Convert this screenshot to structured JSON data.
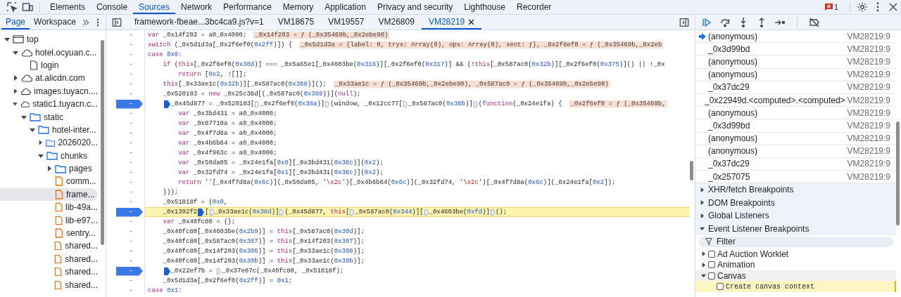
{
  "devtools_tabs": [
    {
      "label": "Elements",
      "selected": false
    },
    {
      "label": "Console",
      "selected": false
    },
    {
      "label": "Sources",
      "selected": true
    },
    {
      "label": "Network",
      "selected": false
    },
    {
      "label": "Performance",
      "selected": false
    },
    {
      "label": "Memory",
      "selected": false
    },
    {
      "label": "Application",
      "selected": false
    },
    {
      "label": "Privacy and security",
      "selected": false
    },
    {
      "label": "Lighthouse",
      "selected": false
    },
    {
      "label": "Recorder",
      "selected": false
    }
  ],
  "issues_count": "1",
  "navigator_tabs": [
    {
      "label": "Page",
      "selected": true
    },
    {
      "label": "Workspace",
      "selected": false
    }
  ],
  "file_tree": [
    {
      "label": "top",
      "kind": "frame",
      "expanded": true,
      "selected": false,
      "children": [
        {
          "label": "hotel.ocyuan.c...",
          "kind": "domain",
          "expanded": true,
          "selected": false,
          "children": [
            {
              "label": "login",
              "kind": "document",
              "selected": false
            }
          ]
        },
        {
          "label": "at.alicdn.com",
          "kind": "domain",
          "expanded": false,
          "selected": false
        },
        {
          "label": "images.tuyacn....",
          "kind": "domain",
          "expanded": false,
          "selected": false
        },
        {
          "label": "static1.tuyacn.c...",
          "kind": "domain",
          "expanded": true,
          "selected": false,
          "children": [
            {
              "label": "static",
              "kind": "folder",
              "expanded": true,
              "selected": false,
              "children": [
                {
                  "label": "hotel-inter...",
                  "kind": "folder",
                  "expanded": true,
                  "selected": false,
                  "children": [
                    {
                      "label": "2026020...",
                      "kind": "folder",
                      "expanded": false,
                      "selected": false
                    },
                    {
                      "label": "chunks",
                      "kind": "folder",
                      "expanded": true,
                      "selected": false,
                      "children": [
                        {
                          "label": "pages",
                          "kind": "folder",
                          "expanded": false,
                          "selected": false
                        },
                        {
                          "label": "comm...",
                          "kind": "script",
                          "selected": false
                        },
                        {
                          "label": "frame...",
                          "kind": "script",
                          "selected": true
                        },
                        {
                          "label": "lib-49a...",
                          "kind": "script",
                          "selected": false
                        },
                        {
                          "label": "lib-e97...",
                          "kind": "script",
                          "selected": false
                        },
                        {
                          "label": "sentry...",
                          "kind": "script",
                          "selected": false
                        },
                        {
                          "label": "shared...",
                          "kind": "script",
                          "selected": false
                        },
                        {
                          "label": "shared...",
                          "kind": "script",
                          "selected": false
                        },
                        {
                          "label": "shared...",
                          "kind": "script",
                          "selected": false
                        },
                        {
                          "label": "shared...",
                          "kind": "script",
                          "selected": false
                        }
                      ]
                    }
                  ]
                }
              ]
            }
          ]
        }
      ]
    }
  ],
  "editor_tabs": [
    {
      "label": "framework-fbeae...3bc4ca9.js?v=1",
      "selected": false
    },
    {
      "label": "VM18675",
      "selected": false
    },
    {
      "label": "VM19557",
      "selected": false
    },
    {
      "label": "VM26809",
      "selected": false
    },
    {
      "label": "VM28219",
      "selected": true
    }
  ],
  "code_lines": [
    {
      "gutter": "–",
      "breakpoint": false,
      "current": false,
      "text": "var _0x14f203 = a0_0x4000;",
      "inline_value": "_0x14f203 = ƒ (_0x35469b,_0x2ebe90)"
    },
    {
      "gutter": "–",
      "breakpoint": false,
      "current": false,
      "text": "switch (_0x5d1d3a[_0x2f6ef0(0x2ff)]) {",
      "inline_value": "_0x5d1d3a = {label: 0, trys: Array(0), ops: Array(0), sent: ƒ}, _0x2f6ef0 = ƒ (_0x35469b,_0x2eb"
    },
    {
      "gutter": "–",
      "breakpoint": false,
      "current": false,
      "text": "case 0x0:",
      "children": [
        {
          "gutter": "–",
          "breakpoint": false,
          "current": false,
          "text": "if (this[_0x2f6ef0(0x30d)] === _0x5a65e1[_0x4603be(0x316)][_0x2f6ef0(0x317)] && (!this[_0x587ac0(0x32b)][_0x2f6ef0(0x375)]() || !_0x",
          "children": [
            {
              "gutter": "–",
              "breakpoint": false,
              "current": false,
              "text": "return [0x2, ![]];"
            }
          ]
        },
        {
          "gutter": "–",
          "breakpoint": false,
          "current": false,
          "text": "this[_0x33ae1c(0x32b)][_0x587ac0(0x388)]();",
          "inline_value": "_0x33ae1c = ƒ (_0x35469b,_0x2ebe90), _0x587ac0 = ƒ (_0x35469b,_0x2ebe90)"
        },
        {
          "gutter": "–",
          "breakpoint": false,
          "current": false,
          "text": "_0x520183 = new _0x25c36d[(_0x587ac0(0x389))](null);"
        },
        {
          "gutter": "–",
          "breakpoint": true,
          "current": false,
          "segments": [
            {
              "text": "_0x45d877 = _0x520183[",
              "marker": true,
              "active": true
            },
            {
              "text": "_0x2f6ef0(0x38a)]",
              "marker": true,
              "active": false
            },
            {
              "text": "(window, _0x12cc77[",
              "marker": true,
              "active": false
            },
            {
              "text": "_0x587ac0(0x38b)]",
              "marker": true,
              "active": false
            },
            {
              "text": "(function(_0x24e1fa) {",
              "marker": true,
              "active": false
            }
          ],
          "inline_value": "_0x2f6ef0 = ƒ (_0x35469b,",
          "children": [
            {
              "gutter": "–",
              "breakpoint": false,
              "current": false,
              "text": "var _0x3bd431 = a0_0x4000;"
            },
            {
              "gutter": "–",
              "breakpoint": false,
              "current": false,
              "text": "var _0x87710a = a0_0x4000;"
            },
            {
              "gutter": "–",
              "breakpoint": false,
              "current": false,
              "text": "var _0x4f7d8a = a0_0x4000;"
            },
            {
              "gutter": "–",
              "breakpoint": false,
              "current": false,
              "text": "var _0x4b6b64 = a0_0x4000;"
            },
            {
              "gutter": "–",
              "breakpoint": false,
              "current": false,
              "text": "var _0x4f963c = a0_0x4000;"
            },
            {
              "gutter": "–",
              "breakpoint": false,
              "current": false,
              "text": "var _0x50da05 = _0x24e1fa[0x0][_0x3bd431(0x38c)](0x2);"
            },
            {
              "gutter": "–",
              "breakpoint": false,
              "current": false,
              "text": "var _0x32fd74 = _0x24e1fa[0x1][_0x3bd431(0x38c)](0x2);"
            },
            {
              "gutter": "–",
              "breakpoint": false,
              "current": false,
              "text": "return ''[_0x4f7d8a(0x6c)](_0x50da05, '\\x2c')[_0x4b6b64(0x6c)](_0x32fd74, '\\x2c')[_0x4f7d8a(0x6c)](_0x24e1fa[0x2]);"
            }
          ]
        },
        {
          "gutter": "–",
          "breakpoint": false,
          "current": false,
          "text": "}));"
        },
        {
          "gutter": "–",
          "breakpoint": false,
          "current": false,
          "text": "_0x51818f = (0x0,"
        },
        {
          "gutter": "–",
          "breakpoint": true,
          "current": true,
          "segments": [
            {
              "text": "_0x1392f2",
              "marker": false
            },
            {
              "text": "[",
              "marker": true,
              "active": true
            },
            {
              "text": "_0x33ae1c(0x38d)]",
              "marker": true,
              "active": false
            },
            {
              "text": "(_0x45d877, this[",
              "marker": true,
              "active": false
            },
            {
              "text": "_0x587ac0(0x344)][",
              "marker": true,
              "active": false
            },
            {
              "text": "_0x4603be(0xfd)]",
              "marker": true,
              "active": false
            },
            {
              "text": "();",
              "marker": true,
              "active": false
            }
          ]
        },
        {
          "gutter": "–",
          "breakpoint": false,
          "current": false,
          "text": "var _0x40fc80 = {};"
        },
        {
          "gutter": "–",
          "breakpoint": false,
          "current": false,
          "text": "_0x40fc80[_0x4603be(0x2b9)] = this[_0x587ac0(0x30d)];"
        },
        {
          "gutter": "–",
          "breakpoint": false,
          "current": false,
          "text": "_0x40fc80[_0x587ac0(0x307)] = this[_0x14f203(0x307)];"
        },
        {
          "gutter": "–",
          "breakpoint": false,
          "current": false,
          "text": "_0x40fc80[_0x14f203(0x306)] = this[_0x33ae1c(0x306)];"
        },
        {
          "gutter": "–",
          "breakpoint": false,
          "current": false,
          "text": "_0x40fc80[_0x14f203(0x30b)] = this[_0x33ae1c(0x30b)];"
        },
        {
          "gutter": "–",
          "breakpoint": true,
          "current": false,
          "segments": [
            {
              "text": "_0x22ef7b = ",
              "marker": true,
              "active": true
            },
            {
              "text": "_0x37e87c(_0x40fc80, _0x51818f);",
              "marker": true,
              "active": false
            }
          ]
        },
        {
          "gutter": "–",
          "breakpoint": false,
          "current": false,
          "text": "_0x5d1d3a[_0x2f6ef0(0x2ff)] = 0x1;"
        }
      ]
    },
    {
      "gutter": "–",
      "breakpoint": false,
      "current": false,
      "text": "case 0x1:"
    }
  ],
  "call_stack": [
    {
      "name": "(anonymous)",
      "location": "VM28219:9",
      "selected": true
    },
    {
      "name": "_0x3d99bd",
      "location": "VM28219:9",
      "selected": false
    },
    {
      "name": "(anonymous)",
      "location": "VM28219:9",
      "selected": false
    },
    {
      "name": "(anonymous)",
      "location": "VM28219:9",
      "selected": false
    },
    {
      "name": "_0x37dc29",
      "location": "VM28219:9",
      "selected": false
    },
    {
      "name": "_0x22949d.<computed>.<computed>",
      "location": "VM28219:9",
      "selected": false
    },
    {
      "name": "(anonymous)",
      "location": "VM28219:9",
      "selected": false
    },
    {
      "name": "_0x3d99bd",
      "location": "VM28219:9",
      "selected": false
    },
    {
      "name": "(anonymous)",
      "location": "VM28219:9",
      "selected": false
    },
    {
      "name": "(anonymous)",
      "location": "VM28219:9",
      "selected": false
    },
    {
      "name": "_0x37dc29",
      "location": "VM28219:9",
      "selected": false
    },
    {
      "name": "_0x257075",
      "location": "VM28219:9",
      "selected": false
    }
  ],
  "breakpoint_sections": [
    {
      "label": "XHR/fetch Breakpoints",
      "expanded": false
    },
    {
      "label": "DOM Breakpoints",
      "expanded": false
    },
    {
      "label": "Global Listeners",
      "expanded": false
    },
    {
      "label": "Event Listener Breakpoints",
      "expanded": true
    }
  ],
  "filter": {
    "placeholder": "Filter"
  },
  "event_categories": [
    {
      "label": "Ad Auction Worklet",
      "expanded": false,
      "checked": false
    },
    {
      "label": "Animation",
      "expanded": false,
      "checked": false
    },
    {
      "label": "Canvas",
      "expanded": true,
      "checked": false,
      "children": [
        {
          "label": "Create canvas context",
          "checked": false,
          "selected": true
        }
      ]
    }
  ]
}
